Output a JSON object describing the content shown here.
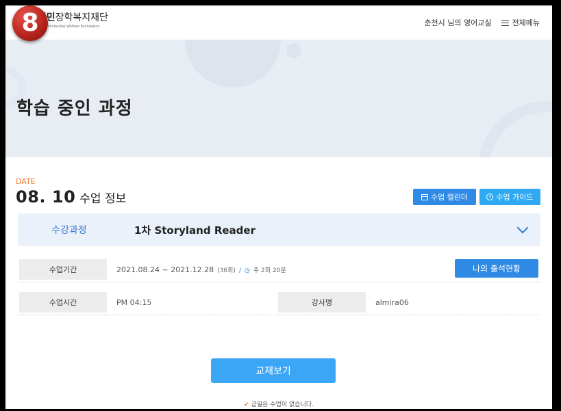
{
  "badge": "8",
  "header": {
    "logo_prefix": "천시민",
    "logo_suffix": "장학복지재단",
    "logo_sub": "n Citizen Scholarship Welfare Foundation",
    "user_class": "춘천시 님의 영어교실",
    "menu_label": "전체메뉴"
  },
  "hero": {
    "title": "학습 중인 과정"
  },
  "lesson": {
    "date_label": "DATE",
    "date_value": "08. 10",
    "date_suffix": "수업 정보",
    "calendar_button": "수업 캘린더",
    "guide_button": "수업 가이드",
    "course_label": "수강과정",
    "course_selected": "1차 Storyland Reader",
    "period_label": "수업기간",
    "period_value": "2021.08.24 ~ 2021.12.28",
    "period_sessions": "(36회)",
    "period_sep": "/",
    "period_weekly": "주 2회 20분",
    "attendance_button": "나의 출석현황",
    "time_label": "수업시간",
    "time_value": "PM 04:15",
    "teacher_label": "강사명",
    "teacher_value": "almira06",
    "book_button": "교재보기",
    "notice_text": "금일은 수업이 없습니다."
  },
  "colors": {
    "accent_blue": "#2f8ae6",
    "light_blue": "#2ea9f2",
    "date_orange": "#f07a2f",
    "badge_red": "#c0281f"
  }
}
